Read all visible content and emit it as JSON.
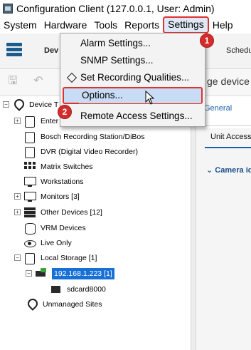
{
  "window": {
    "title": "Configuration Client (127.0.0.1, User: Admin)"
  },
  "menubar": [
    "System",
    "Hardware",
    "Tools",
    "Reports",
    "Settings",
    "Help"
  ],
  "ribbon": {
    "devices_label": "Dev",
    "schedules_label": "Schedul"
  },
  "toolbar": {
    "hint_text": "ge device"
  },
  "settings_menu": {
    "items": [
      {
        "label": "Alarm Settings..."
      },
      {
        "label": "SNMP Settings..."
      },
      {
        "label": "Set Recording Qualities..."
      },
      {
        "label": "Options..."
      },
      {
        "label": "Remote Access Settings..."
      }
    ]
  },
  "badges": {
    "step1": "1",
    "step2": "2"
  },
  "tree": {
    "root": "Device T",
    "items": [
      {
        "label": "Enter",
        "icon": "box-icon"
      },
      {
        "label": "Bosch Recording Station/DiBos",
        "icon": "box-icon"
      },
      {
        "label": "DVR (Digital Video Recorder)",
        "icon": "box-icon"
      },
      {
        "label": "Matrix Switches",
        "icon": "grid-icon"
      },
      {
        "label": "Workstations",
        "icon": "monitor-icon"
      },
      {
        "label": "Monitors [3]",
        "icon": "monitor-icon"
      },
      {
        "label": "Other Devices [12]",
        "icon": "stack-icon"
      },
      {
        "label": "VRM Devices",
        "icon": "disk-icon"
      },
      {
        "label": "Live Only",
        "icon": "eye-icon"
      },
      {
        "label": "Local Storage [1]",
        "icon": "box-icon"
      },
      {
        "label": "192.168.1.223 [1]",
        "icon": "ip-device-icon"
      },
      {
        "label": "sdcard8000",
        "icon": "sd-card-icon"
      },
      {
        "label": "Unmanaged Sites",
        "icon": "pin-icon"
      }
    ]
  },
  "right_pane": {
    "tab_general": "General",
    "unit_access": "Unit Access",
    "camera_section": "Camera id"
  },
  "colors": {
    "highlight_border": "#e03030",
    "selection": "#1670d6",
    "badge": "#d42b2b"
  }
}
